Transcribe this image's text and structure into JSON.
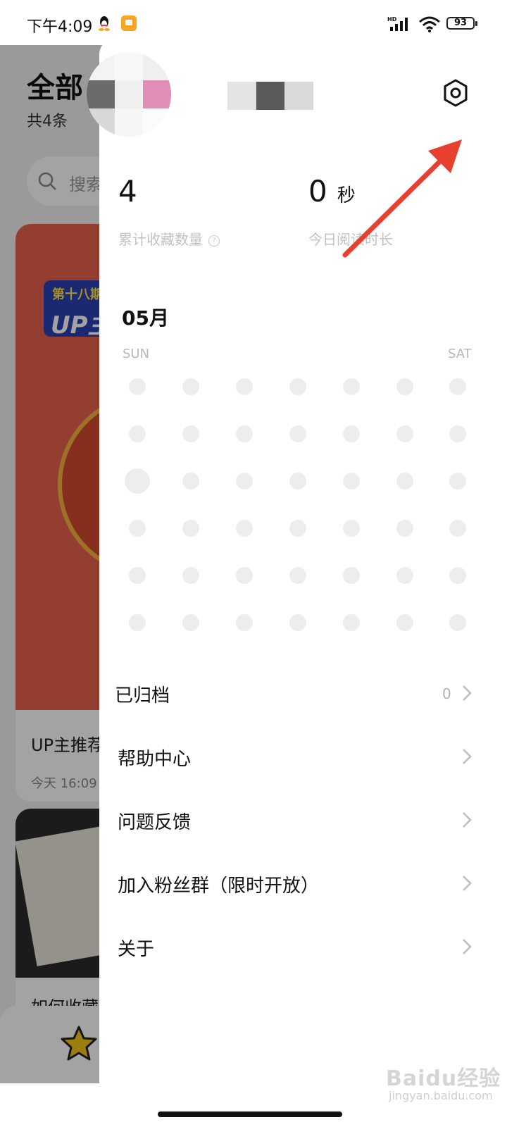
{
  "status_bar": {
    "time": "下午4:09",
    "battery": "93",
    "icons": [
      "qq-icon",
      "app-notification-icon",
      "hd-signal-icon",
      "wifi-icon",
      "battery-icon"
    ]
  },
  "background_page": {
    "title": "全部",
    "count": "共4条",
    "search_placeholder": "搜索",
    "card1": {
      "badge_top": "第十八期",
      "badge_main": "UP主",
      "title": "UP主推荐",
      "time": "今天 16:09"
    },
    "card2": {
      "title": "如何收藏"
    }
  },
  "drawer": {
    "stats": [
      {
        "value": "4",
        "unit": "",
        "label": "累计收藏数量",
        "has_help": true
      },
      {
        "value": "0",
        "unit": "秒",
        "label": "今日阅读时长",
        "has_help": false
      }
    ],
    "calendar": {
      "month": "05月",
      "first_day": "SUN",
      "last_day": "SAT",
      "rows": 6,
      "cols": 7,
      "today_row": 2,
      "today_col": 0
    },
    "menu": [
      {
        "label": "已归档",
        "count": "0"
      },
      {
        "label": "帮助中心",
        "count": ""
      },
      {
        "label": "问题反馈",
        "count": ""
      },
      {
        "label": "加入粉丝群（限时开放）",
        "count": ""
      },
      {
        "label": "关于",
        "count": ""
      }
    ]
  },
  "watermark": {
    "logo": "Baidu经验",
    "url": "jingyan.baidu.com"
  },
  "colors": {
    "annotation_arrow": "#e8402e",
    "dot": "#ededee",
    "label_gray": "#c2c2c2"
  }
}
